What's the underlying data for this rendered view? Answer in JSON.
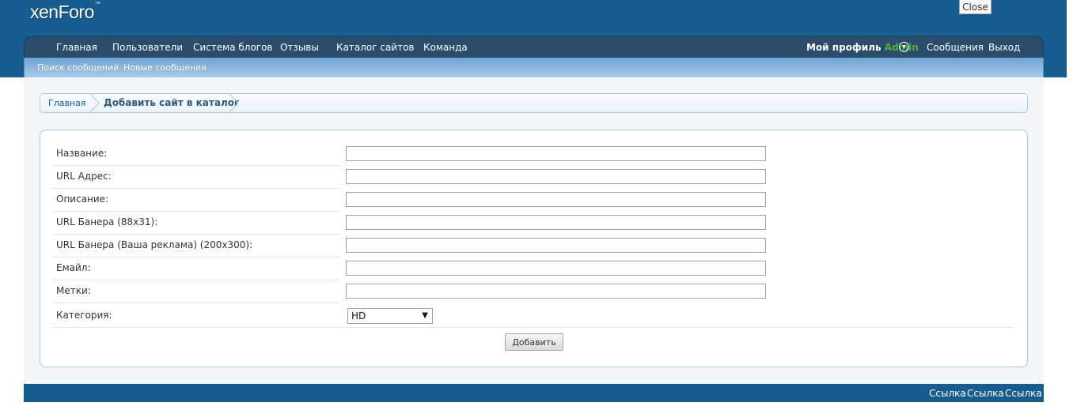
{
  "header": {
    "logo": "xenForo",
    "logo_mark": "™",
    "close_label": "Close"
  },
  "nav": {
    "items": [
      "Главная",
      "Пользователи",
      "Система блогов",
      "Отзывы",
      "Каталог сайтов",
      "Команда"
    ],
    "profile_label": "Мой профиль",
    "username": "Admin",
    "messages": "Сообщения",
    "logout": "Выход"
  },
  "subnav": {
    "items": [
      "Поиск сообщений",
      "Новые сообщения"
    ]
  },
  "breadcrumb": {
    "home": "Главная",
    "current": "Добавить сайт в каталог"
  },
  "form": {
    "fields": [
      {
        "label": "Название:",
        "value": ""
      },
      {
        "label": "URL Адрес:",
        "value": ""
      },
      {
        "label": "Описание:",
        "value": ""
      },
      {
        "label": "URL Банера (88x31):",
        "value": ""
      },
      {
        "label": "URL Банера (Ваша реклама) (200x300):",
        "value": ""
      },
      {
        "label": "Емайл:",
        "value": ""
      },
      {
        "label": "Метки:",
        "value": ""
      }
    ],
    "category_label": "Категория:",
    "category_value": "HD",
    "submit_label": "Добавить"
  },
  "footer": {
    "links": [
      "Ссылка",
      "Ссылка",
      "Ссылка"
    ]
  },
  "colors": {
    "header_bg": "#185d8f",
    "navbar_bg": "#2b4c6b",
    "username": "#4cb13a",
    "breadcrumb_border": "#a5cae4"
  },
  "icons": {
    "profile_dropdown": "chevron-down-icon",
    "select_arrow": "triangle-down-icon",
    "breadcrumb_separator": "chevron-right-icon"
  }
}
